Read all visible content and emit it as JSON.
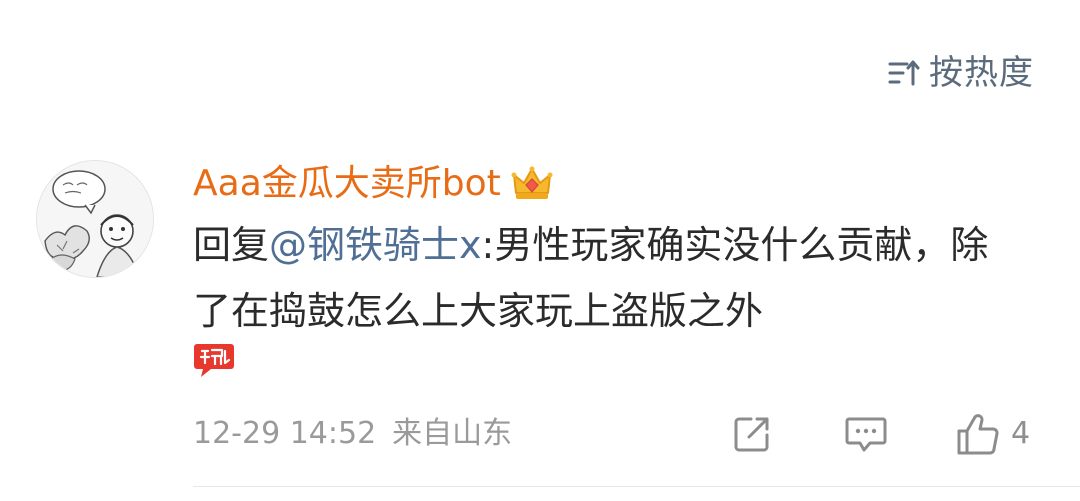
{
  "sort": {
    "icon": "sort-lines-icon",
    "label": "按热度"
  },
  "comment": {
    "avatar_icon": "sketch-avatar",
    "username": "Aaa金瓜大卖所bot",
    "badge_icon": "crown-icon",
    "reply_prefix": "回复",
    "mention": "@钢铁骑士x",
    "text": ":男性玩家确实没什么贡献，除了在捣鼓怎么上大家玩上盗版之外",
    "sticker_icon": "geili-sticker-icon",
    "date": "12-29 14:52",
    "location": "来自山东",
    "like_count": "4"
  },
  "colors": {
    "username": "#e86b16",
    "mention": "#4f6f95",
    "meta": "#9a9a9a"
  }
}
